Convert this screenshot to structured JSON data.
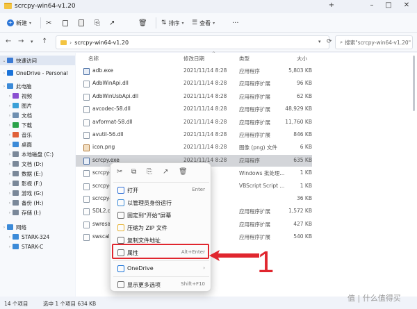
{
  "window": {
    "title": "scrcpy-win64-v1.20"
  },
  "toolbar": {
    "new_label": "新建",
    "sort_label": "排序",
    "view_label": "查看"
  },
  "nav": {
    "address_path": "scrcpy-win64-v1.20",
    "search_placeholder": "搜索\"scrcpy-win64-v1.20\""
  },
  "sidebar": {
    "items": [
      {
        "label": "快速访问",
        "icon": "star-icon",
        "color": "#3c7bd4"
      },
      {
        "label": "OneDrive - Personal",
        "icon": "cloud-icon",
        "color": "#1a73d9"
      },
      {
        "label": "此电脑",
        "icon": "pc-icon",
        "color": "#3b8ad8"
      },
      {
        "label": "视频",
        "icon": "video-icon",
        "color": "#8a4fd1"
      },
      {
        "label": "图片",
        "icon": "image-icon",
        "color": "#3aa0d8"
      },
      {
        "label": "文档",
        "icon": "document-icon",
        "color": "#6f8fb0"
      },
      {
        "label": "下载",
        "icon": "download-icon",
        "color": "#2aa34a"
      },
      {
        "label": "音乐",
        "icon": "music-icon",
        "color": "#e0613a"
      },
      {
        "label": "桌面",
        "icon": "desktop-icon",
        "color": "#3b8ad8"
      },
      {
        "label": "本地磁盘 (C:)",
        "icon": "drive-icon",
        "color": "#7a8899"
      },
      {
        "label": "文档 (D:)",
        "icon": "drive-icon",
        "color": "#7a8899"
      },
      {
        "label": "数据 (E:)",
        "icon": "drive-icon",
        "color": "#7a8899"
      },
      {
        "label": "影视 (F:)",
        "icon": "drive-icon",
        "color": "#7a8899"
      },
      {
        "label": "游戏 (G:)",
        "icon": "drive-icon",
        "color": "#7a8899"
      },
      {
        "label": "备份 (H:)",
        "icon": "drive-icon",
        "color": "#7a8899"
      },
      {
        "label": "存储 (I:)",
        "icon": "drive-icon",
        "color": "#7a8899"
      },
      {
        "label": "网络",
        "icon": "network-icon",
        "color": "#3b8ad8"
      },
      {
        "label": "STARK-324",
        "icon": "computer-icon",
        "color": "#3b8ad8"
      },
      {
        "label": "STARK-C",
        "icon": "computer-icon",
        "color": "#3b8ad8"
      }
    ]
  },
  "columns": {
    "name": "名称",
    "date": "修改日期",
    "type": "类型",
    "size": "大小"
  },
  "files": [
    {
      "name": "adb.exe",
      "date": "2021/11/14 8:28",
      "type": "应用程序",
      "size": "5,803 KB",
      "kind": "exe"
    },
    {
      "name": "AdbWinApi.dll",
      "date": "2021/11/14 8:28",
      "type": "应用程序扩展",
      "size": "96 KB",
      "kind": "dll"
    },
    {
      "name": "AdbWinUsbApi.dll",
      "date": "2021/11/14 8:28",
      "type": "应用程序扩展",
      "size": "62 KB",
      "kind": "dll"
    },
    {
      "name": "avcodec-58.dll",
      "date": "2021/11/14 8:28",
      "type": "应用程序扩展",
      "size": "48,929 KB",
      "kind": "dll"
    },
    {
      "name": "avformat-58.dll",
      "date": "2021/11/14 8:28",
      "type": "应用程序扩展",
      "size": "11,760 KB",
      "kind": "dll"
    },
    {
      "name": "avutil-56.dll",
      "date": "2021/11/14 8:28",
      "type": "应用程序扩展",
      "size": "846 KB",
      "kind": "dll"
    },
    {
      "name": "icon.png",
      "date": "2021/11/14 8:28",
      "type": "图像 (png) 文件",
      "size": "6 KB",
      "kind": "png"
    },
    {
      "name": "scrcpy.exe",
      "date": "2021/11/14 8:28",
      "type": "应用程序",
      "size": "635 KB",
      "kind": "exe"
    },
    {
      "name": "scrcpy-c",
      "date": "",
      "type": "Windows 批处理...",
      "size": "1 KB",
      "kind": "bat"
    },
    {
      "name": "scrcpy-n",
      "date": "",
      "type": "VBScript Script ...",
      "size": "1 KB",
      "kind": "vbs"
    },
    {
      "name": "scrcpy-s",
      "date": "",
      "type": "",
      "size": "36 KB",
      "kind": "file"
    },
    {
      "name": "SDL2.dll",
      "date": "",
      "type": "应用程序扩展",
      "size": "1,572 KB",
      "kind": "dll"
    },
    {
      "name": "swresam",
      "date": "",
      "type": "应用程序扩展",
      "size": "427 KB",
      "kind": "dll"
    },
    {
      "name": "swscale-",
      "date": "",
      "type": "应用程序扩展",
      "size": "540 KB",
      "kind": "dll"
    }
  ],
  "status": {
    "count": "14 个项目",
    "selection": "选中 1 个项目  634 KB"
  },
  "context_menu": {
    "items": [
      {
        "label": "打开",
        "shortcut": "Enter",
        "icon": "open-icon",
        "color": "#2f6fd6"
      },
      {
        "label": "以管理员身份运行",
        "shortcut": "",
        "icon": "shield-icon",
        "color": "#3b8ad8"
      },
      {
        "label": "固定到\"开始\"屏幕",
        "shortcut": "",
        "icon": "pin-icon",
        "color": "#6b6b6b"
      },
      {
        "label": "压缩为 ZIP 文件",
        "shortcut": "",
        "icon": "zip-icon",
        "color": "#e6b12c"
      },
      {
        "label": "复制文件地址",
        "shortcut": "",
        "icon": "copy-path-icon",
        "color": "#6b6b6b"
      },
      {
        "label": "属性",
        "shortcut": "Alt+Enter",
        "icon": "properties-icon",
        "color": "#6b6b6b"
      },
      {
        "label": "OneDrive",
        "shortcut": "›",
        "icon": "cloud-icon",
        "color": "#1a73d9"
      },
      {
        "label": "显示更多选项",
        "shortcut": "Shift+F10",
        "icon": "more-options-icon",
        "color": "#6b6b6b"
      }
    ]
  },
  "annotation": {
    "number": "1",
    "color": "#e0262e"
  },
  "watermark": "值 | 什么值得买"
}
